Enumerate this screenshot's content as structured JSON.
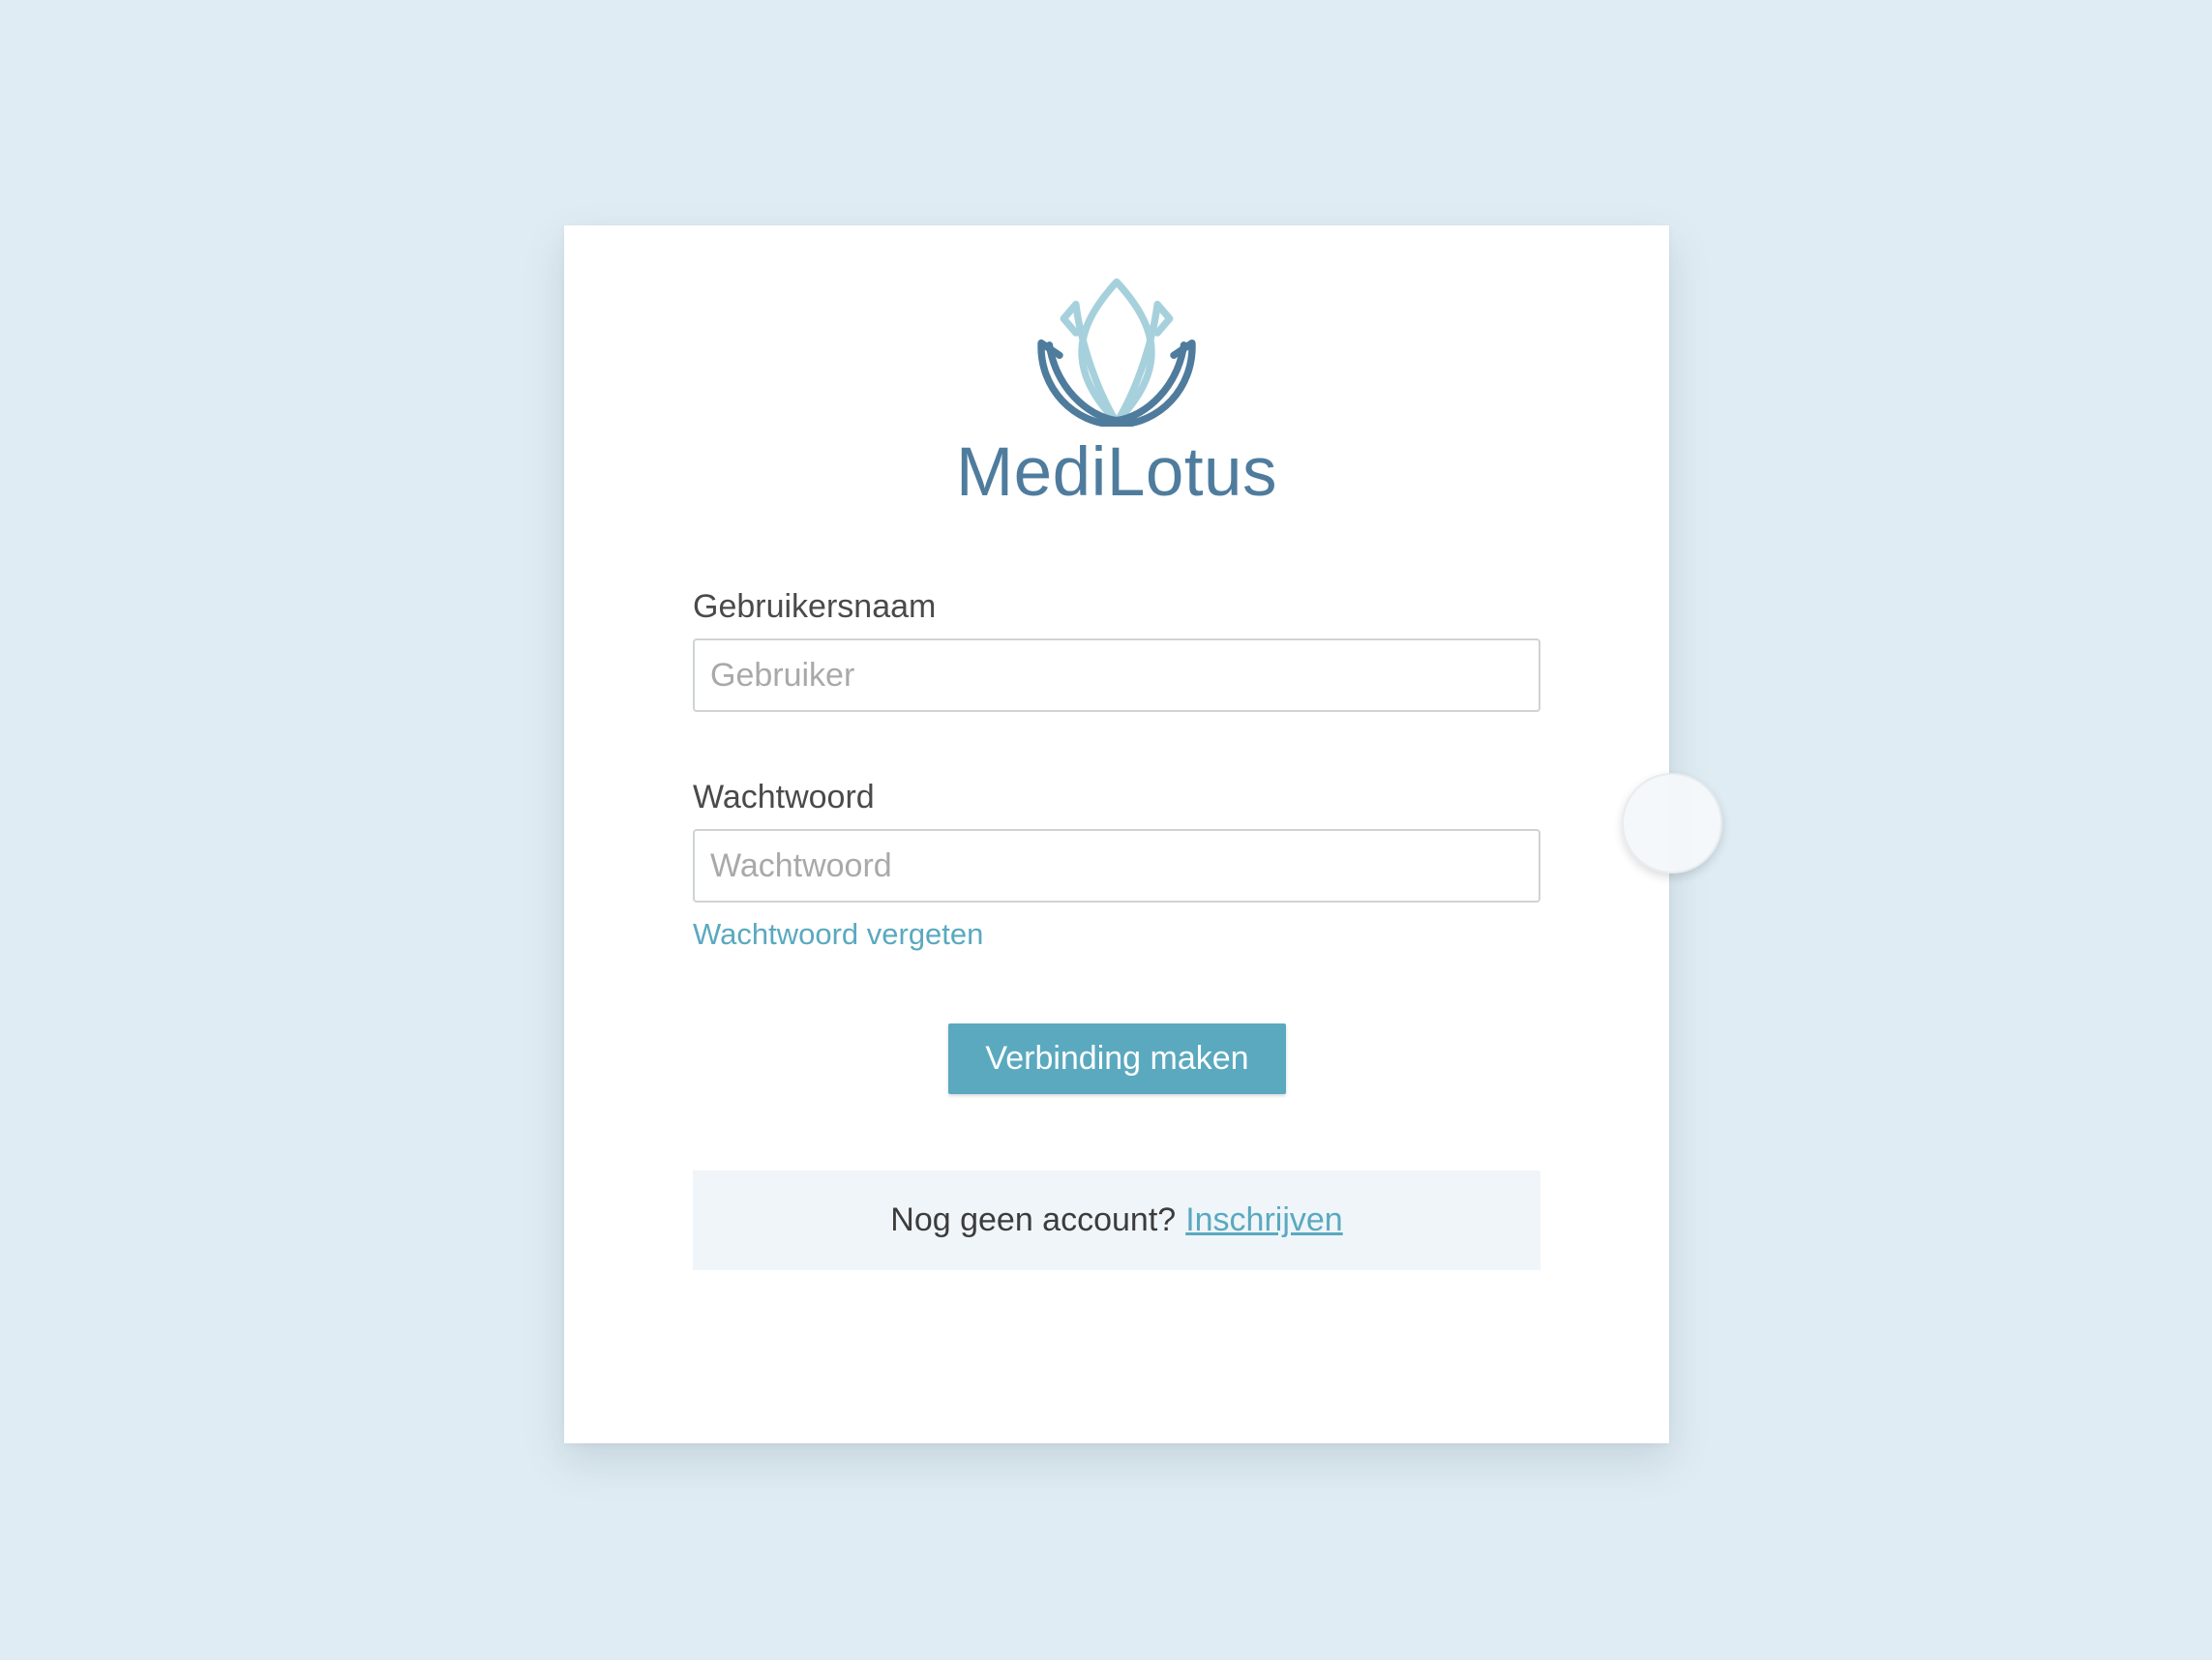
{
  "brand": {
    "name": "MediLotus",
    "logo_icon": "lotus-icon",
    "primary_color": "#4f7c9d",
    "accent_color": "#5aa9bf",
    "light_color": "#a6d1dc"
  },
  "login_form": {
    "username": {
      "label": "Gebruikersnaam",
      "placeholder": "Gebruiker",
      "value": ""
    },
    "password": {
      "label": "Wachtwoord",
      "placeholder": "Wachtwoord",
      "value": ""
    },
    "forgot_password_label": "Wachtwoord vergeten",
    "submit_label": "Verbinding maken"
  },
  "signup": {
    "prompt": "Nog geen account?",
    "link_label": "Inschrijven"
  },
  "colors": {
    "background": "#dfecf3",
    "card": "#ffffff",
    "signup_box": "#eff5f9"
  }
}
